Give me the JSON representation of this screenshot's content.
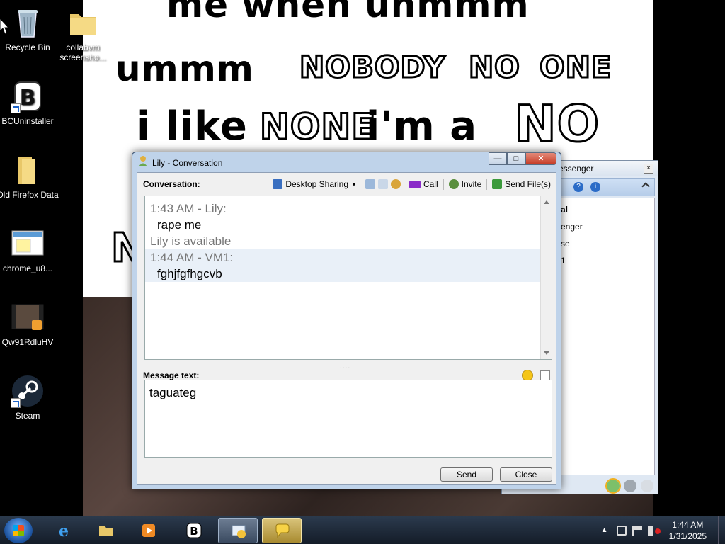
{
  "wallpaper": {
    "lines": [
      "me when uhmmm",
      "ummm",
      "NOBODY",
      "NO",
      "ONE",
      "i like",
      "NONE",
      "i'm a",
      "NO",
      "N"
    ]
  },
  "desktop_icons": [
    {
      "label": "Recycle Bin",
      "icon": "recycle-bin-icon"
    },
    {
      "label": "collabvm screensho...",
      "icon": "folder-icon"
    },
    {
      "label": "BCUninstaller",
      "icon": "bcuninstaller-icon"
    },
    {
      "label": "Old Firefox Data",
      "icon": "folder-icon"
    },
    {
      "label": "chrome_u8...",
      "icon": "image-file-icon"
    },
    {
      "label": "Qw91RdluHV",
      "icon": "video-file-icon"
    },
    {
      "label": "Steam",
      "icon": "steam-icon"
    }
  ],
  "messenger": {
    "title_fragment": "essenger",
    "items": [
      "al",
      "enger",
      "se",
      "1"
    ]
  },
  "conversation": {
    "title": "Lily - Conversation",
    "conversation_label": "Conversation:",
    "toolbar": {
      "desktop_sharing": "Desktop Sharing",
      "call": "Call",
      "invite": "Invite",
      "send_files": "Send File(s)"
    },
    "history": [
      {
        "meta": "1:43 AM - Lily:",
        "message": "rape me",
        "from": "lily"
      },
      {
        "status": "Lily is available"
      },
      {
        "meta": "1:44 AM - VM1:",
        "message": "fghjfgfhgcvb",
        "from": "vm1"
      }
    ],
    "message_label": "Message text:",
    "compose_text": "taguateg",
    "send_label": "Send",
    "close_label": "Close",
    "grip": "....",
    "window_buttons": {
      "minimize": "—",
      "maximize": "□",
      "close": "✕"
    }
  },
  "taskbar": {
    "clock_time": "1:44 AM",
    "clock_date": "1/31/2025"
  },
  "colors": {
    "window_frame": "#bfd3ea",
    "close_button": "#c53b25",
    "taskbar": "#1a2433"
  }
}
